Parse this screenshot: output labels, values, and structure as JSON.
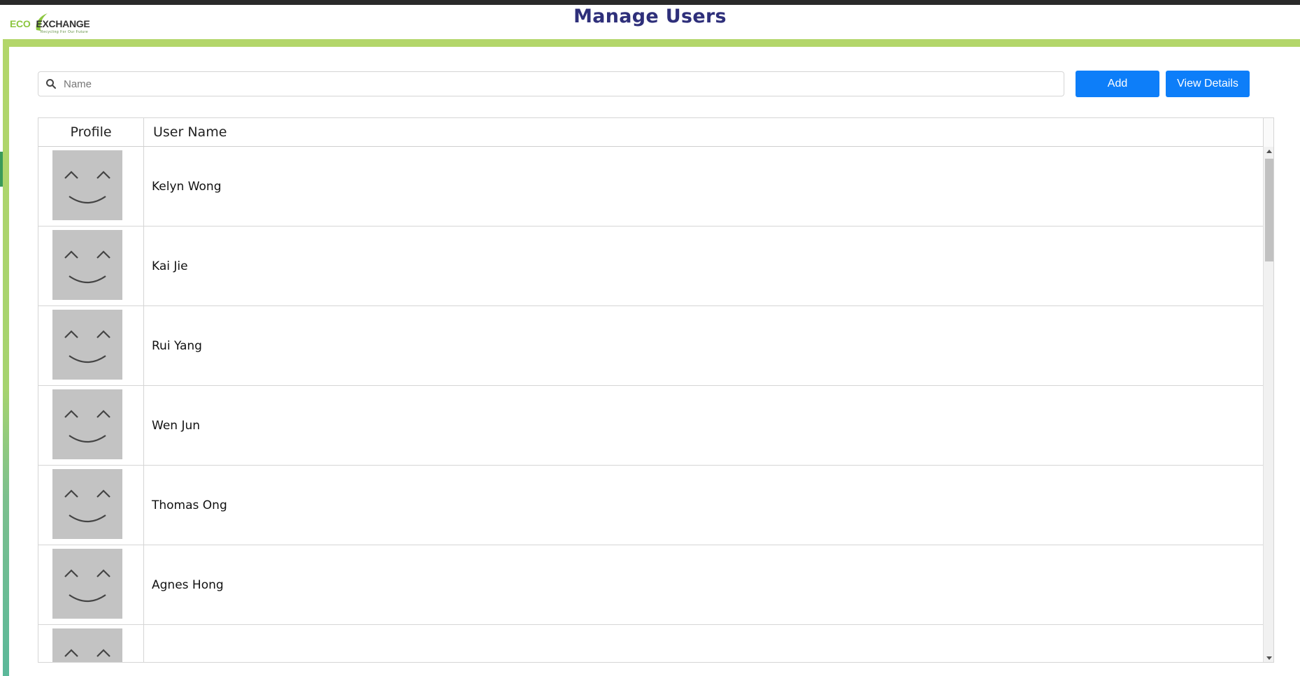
{
  "app": {
    "logo_text_eco": "ECO",
    "logo_text_exchange": "EXCHANGE",
    "logo_tagline": "Recycling For Our Future",
    "page_title": "Manage Users"
  },
  "search": {
    "placeholder": "Name",
    "value": "",
    "icon": "search-icon"
  },
  "toolbar": {
    "add_label": "Add",
    "view_details_label": "View Details"
  },
  "colors": {
    "title": "#2e2f7a",
    "accent_green": "#a6d36e",
    "button_blue": "#0d7ef9",
    "avatar_bg": "#c3c3c3"
  },
  "table": {
    "columns": [
      "Profile",
      "User Name"
    ],
    "rows": [
      {
        "name": "Kelyn Wong",
        "avatar": "smiley-avatar-icon"
      },
      {
        "name": "Kai Jie",
        "avatar": "smiley-avatar-icon"
      },
      {
        "name": "Rui Yang",
        "avatar": "smiley-avatar-icon"
      },
      {
        "name": "Wen Jun",
        "avatar": "smiley-avatar-icon"
      },
      {
        "name": "Thomas Ong",
        "avatar": "smiley-avatar-icon"
      },
      {
        "name": "Agnes Hong",
        "avatar": "smiley-avatar-icon"
      },
      {
        "name": "",
        "avatar": "smiley-avatar-icon"
      }
    ]
  }
}
